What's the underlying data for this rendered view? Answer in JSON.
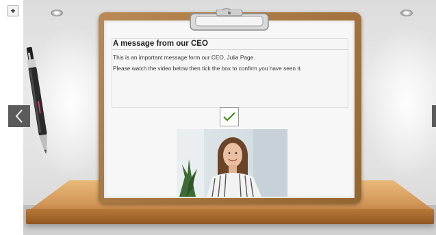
{
  "toolbar": {
    "zoom_label": "+"
  },
  "navigation": {
    "prev_icon": "chevron-left-icon",
    "next_icon": "chevron-right-icon"
  },
  "message": {
    "title": "A message from our CEO",
    "line1": "This is an important message form our CEO, Julia Page.",
    "line2": "Please watch the video below then tick the box to confirm you have seen it."
  },
  "checkbox": {
    "checked": true,
    "icon": "checkmark-icon",
    "color": "#4a8a1f"
  },
  "video": {
    "icon": "video-thumbnail"
  },
  "colors": {
    "nav_button": "#5b5b5b",
    "clipboard": "#a6753f",
    "shelf": "#d9a162"
  }
}
